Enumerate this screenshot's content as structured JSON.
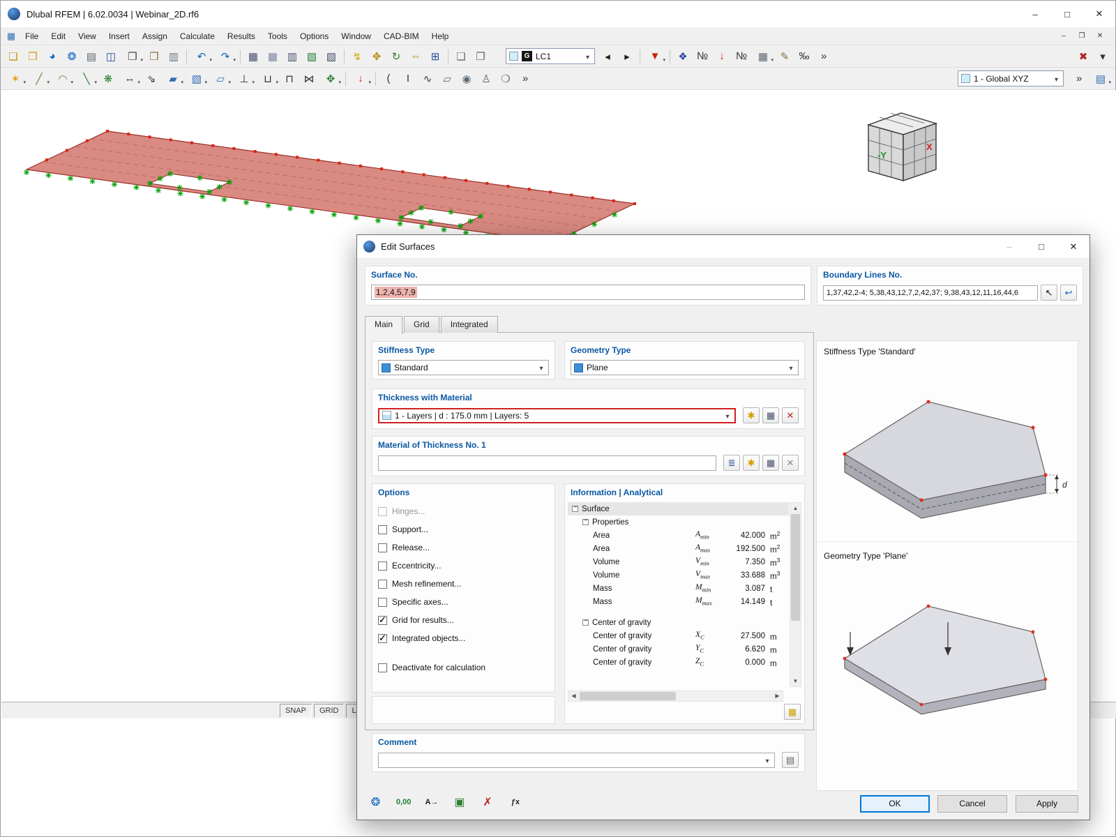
{
  "colors": {
    "label_blue": "#0a58a5",
    "selection_pink": "#f0b4af",
    "highlight_red": "#d02020",
    "surface_red": "#d98a82",
    "support_green": "#00a000",
    "accent_blue": "#0078d7"
  },
  "main_window": {
    "title": "Dlubal RFEM | 6.02.0034 | Webinar_2D.rf6",
    "win_controls": {
      "minimize": "–",
      "maximize": "□",
      "close": "✕"
    },
    "mdi_controls": {
      "minimize": "‒",
      "restore": "❐",
      "close": "✕"
    },
    "menu": [
      "File",
      "Edit",
      "View",
      "Insert",
      "Assign",
      "Calculate",
      "Results",
      "Tools",
      "Options",
      "Window",
      "CAD-BIM",
      "Help"
    ],
    "toolbar_main": [
      {
        "name": "new-model-icon",
        "g": "❏",
        "c": "#c79100"
      },
      {
        "name": "open-model-icon",
        "g": "❐",
        "c": "#d79a00"
      },
      {
        "name": "dlubal-center-icon",
        "g": "◕",
        "c": "#1565c0"
      },
      {
        "name": "dlubal-web-icon",
        "g": "❂",
        "c": "#1565c0"
      },
      {
        "name": "printout-report-icon",
        "g": "▤",
        "c": "#5b6770"
      },
      {
        "name": "save-icon",
        "g": "◫",
        "c": "#24489a"
      },
      {
        "name": "print-icon",
        "g": "❒",
        "c": "#444444",
        "dd": true
      },
      {
        "name": "copy-icon",
        "g": "❐",
        "c": "#8a6d3b"
      },
      {
        "name": "note-icon",
        "g": "▥",
        "c": "#667788"
      },
      {
        "sep": true
      },
      {
        "name": "undo-icon",
        "g": "↶",
        "c": "#1565c0",
        "dd": true
      },
      {
        "name": "redo-icon",
        "g": "↷",
        "c": "#1565c0",
        "dd": true
      },
      {
        "sep": true
      },
      {
        "name": "tables-icon",
        "g": "▦",
        "c": "#44506a"
      },
      {
        "name": "result-tables-icon",
        "g": "▦",
        "c": "#7a86a0"
      },
      {
        "name": "printout-tables-icon",
        "g": "▥",
        "c": "#44506a"
      },
      {
        "name": "export-tables-icon",
        "g": "▧",
        "c": "#1e7e34"
      },
      {
        "name": "table-settings-icon",
        "g": "▨",
        "c": "#44506a"
      },
      {
        "sep": true
      },
      {
        "name": "generate-load-icon",
        "g": "↯",
        "c": "#d2a000"
      },
      {
        "name": "move-copy-icon",
        "g": "✥",
        "c": "#b8860b"
      },
      {
        "name": "rotate-icon",
        "g": "↻",
        "c": "#2e7d32"
      },
      {
        "name": "mirror-icon",
        "g": "⇔",
        "c": "#b8860b"
      },
      {
        "name": "divide-icon",
        "g": "⊞",
        "c": "#24489a"
      },
      {
        "sep": true
      },
      {
        "name": "view-sheet-icon",
        "g": "❏",
        "c": "#5b6770"
      },
      {
        "name": "view-sheet-2-icon",
        "g": "❐",
        "c": "#5b6770"
      }
    ],
    "load_case": {
      "badge": "G",
      "value": "LC1"
    },
    "toolbar_main_right": [
      {
        "name": "previous-load-case-icon",
        "g": "◂",
        "c": "#222222"
      },
      {
        "name": "next-load-case-icon",
        "g": "▸",
        "c": "#222222"
      },
      {
        "sep": true
      },
      {
        "name": "filter-loads-icon",
        "g": "▼",
        "c": "#cc2200",
        "dd": true
      },
      {
        "sep": true
      },
      {
        "name": "display-properties-icon",
        "g": "❖",
        "c": "#24489a"
      },
      {
        "name": "object-numbering-icon",
        "g": "№",
        "c": "#333333"
      },
      {
        "name": "show-loads-icon",
        "g": "↓",
        "c": "#cc2200"
      },
      {
        "name": "show-values-icon",
        "g": "№",
        "c": "#333333"
      },
      {
        "name": "results-grid-icon",
        "g": "▦",
        "c": "#5b6770",
        "dd": true
      },
      {
        "name": "comment-pencil-icon",
        "g": "✎",
        "c": "#8a6d3b"
      },
      {
        "name": "decimals-icon",
        "g": "‰",
        "c": "#333333"
      },
      {
        "name": "toolbar-overflow-icon",
        "g": "»",
        "c": "#333333"
      },
      {
        "spring": true
      },
      {
        "name": "zoom-cancel-icon",
        "g": "✖",
        "c": "#bb2222"
      },
      {
        "name": "toolbar-menu-icon",
        "g": "▾",
        "c": "#333333"
      }
    ],
    "toolbar_insert": [
      {
        "name": "new-node-icon",
        "g": "✶",
        "c": "#e0a000",
        "dd": true
      },
      {
        "name": "new-line-icon",
        "g": "╱",
        "c": "#8a6d3b",
        "dd": true
      },
      {
        "name": "new-arc-icon",
        "g": "◠",
        "c": "#8a6d3b",
        "dd": true
      },
      {
        "name": "new-member-icon",
        "g": "╲",
        "c": "#2e7d32",
        "dd": true
      },
      {
        "name": "new-member-set-icon",
        "g": "❋",
        "c": "#2e7d32"
      },
      {
        "name": "dimension-icon",
        "g": "↔",
        "c": "#333333",
        "dd": true
      },
      {
        "name": "dimension-slope-icon",
        "g": "⇘",
        "c": "#333333"
      },
      {
        "name": "new-surface-icon",
        "g": "▰",
        "c": "#2f6fb5",
        "dd": true
      },
      {
        "name": "new-solid-icon",
        "g": "▧",
        "c": "#2f6fb5",
        "dd": true
      },
      {
        "name": "new-opening-icon",
        "g": "▱",
        "c": "#2f6fb5",
        "dd": true
      },
      {
        "name": "nodal-support-icon",
        "g": "⊥",
        "c": "#333333",
        "dd": true
      },
      {
        "name": "line-support-icon",
        "g": "⊔",
        "c": "#333333",
        "dd": true
      },
      {
        "name": "line-hinge-icon",
        "g": "⊓",
        "c": "#333333"
      },
      {
        "name": "member-hinge-icon",
        "g": "⋈",
        "c": "#333333"
      },
      {
        "name": "surface-axes-icon",
        "g": "✥",
        "c": "#2e7d32",
        "dd": true
      },
      {
        "sep": true
      },
      {
        "name": "new-load-icon",
        "g": "↓",
        "c": "#cc2200",
        "dd": true
      },
      {
        "sep": true
      },
      {
        "name": "section-cut-icon",
        "g": "(",
        "c": "#333333"
      },
      {
        "name": "profile-icon",
        "g": "I",
        "c": "#333333"
      },
      {
        "name": "curve-icon",
        "g": "∿",
        "c": "#333333"
      },
      {
        "name": "clipping-plane-icon",
        "g": "▱",
        "c": "#5b6770"
      },
      {
        "name": "camera-icon",
        "g": "◉",
        "c": "#5b6770"
      },
      {
        "name": "walk-through-icon",
        "g": "♙",
        "c": "#5b6770"
      },
      {
        "name": "rendering-icon",
        "g": "❍",
        "c": "#5b6770"
      },
      {
        "name": "toolbar-overflow-icon",
        "g": "»",
        "c": "#333333"
      }
    ],
    "coord_system": {
      "value": "1 - Global XYZ"
    },
    "toolbar_insert_end": [
      {
        "name": "toolbar-overflow-2-icon",
        "g": "»",
        "c": "#333333"
      },
      {
        "name": "panel-toggle-icon",
        "g": "▤",
        "c": "#2f6fb5",
        "dd": true
      }
    ],
    "status_bar": [
      "SNAP",
      "GRID",
      "LGRID"
    ],
    "nav_cube": {
      "front_label": "-Y",
      "right_label": "X"
    }
  },
  "dialog": {
    "title": "Edit Surfaces",
    "controls": {
      "minimize": "–",
      "maximize": "□",
      "close": "✕"
    },
    "surface_no": {
      "label": "Surface No.",
      "value": "1,2,4,5,7,9"
    },
    "boundary_lines": {
      "label": "Boundary Lines No.",
      "value": "1,37,42,2-4; 5,38,43,12,7,2,42,37; 9,38,43,12,11,16,44,6"
    },
    "tabs": [
      {
        "label": "Main",
        "active": true
      },
      {
        "label": "Grid"
      },
      {
        "label": "Integrated"
      }
    ],
    "stiffness_type": {
      "label": "Stiffness Type",
      "value": "Standard"
    },
    "geometry_type": {
      "label": "Geometry Type",
      "value": "Plane"
    },
    "thickness": {
      "label": "Thickness with Material",
      "value": "1 - Layers | d : 175.0 mm | Layers: 5"
    },
    "material": {
      "label": "Material of Thickness No. 1",
      "value": ""
    },
    "options": {
      "label": "Options",
      "items": [
        {
          "label": "Hinges...",
          "disabled": true
        },
        {
          "label": "Support..."
        },
        {
          "label": "Release..."
        },
        {
          "label": "Eccentricity..."
        },
        {
          "label": "Mesh refinement..."
        },
        {
          "label": "Specific axes..."
        },
        {
          "label": "Grid for results...",
          "checked": true
        },
        {
          "label": "Integrated objects...",
          "checked": true
        },
        {
          "label": "Deactivate for calculation",
          "gap": true
        }
      ]
    },
    "information": {
      "label": "Information | Analytical",
      "rows": [
        {
          "label": "Surface",
          "root": true
        },
        {
          "label": "Properties",
          "group": true,
          "indent": 1
        },
        {
          "label": "Area",
          "sym": "A",
          "sub": "min",
          "value": "42.000",
          "unit": "m",
          "sup": "2",
          "leaf": true,
          "indent": 2
        },
        {
          "label": "Area",
          "sym": "A",
          "sub": "max",
          "value": "192.500",
          "unit": "m",
          "sup": "2",
          "leaf": true,
          "indent": 2
        },
        {
          "label": "Volume",
          "sym": "V",
          "sub": "min",
          "value": "7.350",
          "unit": "m",
          "sup": "3",
          "leaf": true,
          "indent": 2
        },
        {
          "label": "Volume",
          "sym": "V",
          "sub": "max",
          "value": "33.688",
          "unit": "m",
          "sup": "3",
          "leaf": true,
          "indent": 2
        },
        {
          "label": "Mass",
          "sym": "M",
          "sub": "min",
          "value": "3.087",
          "unit": "t",
          "leaf": true,
          "indent": 2
        },
        {
          "label": "Mass",
          "sym": "M",
          "sub": "max",
          "value": "14.149",
          "unit": "t",
          "leaf": true,
          "indent": 2
        },
        {
          "spacer": true
        },
        {
          "label": "Center of gravity",
          "group": true,
          "indent": 1
        },
        {
          "label": "Center of gravity",
          "sym": "X",
          "sub": "C",
          "value": "27.500",
          "unit": "m",
          "leaf": true,
          "indent": 2
        },
        {
          "label": "Center of gravity",
          "sym": "Y",
          "sub": "C",
          "value": "6.620",
          "unit": "m",
          "leaf": true,
          "indent": 2
        },
        {
          "label": "Center of gravity",
          "sym": "Z",
          "sub": "C",
          "value": "0.000",
          "unit": "m",
          "leaf": true,
          "indent": 2
        }
      ]
    },
    "icons": {
      "select": "↖",
      "reset": "↩",
      "new_thickness": "✱",
      "edit_thickness": "▦",
      "delete_thickness": "✕",
      "library": "≣",
      "new_material": "✱",
      "edit_material": "▦",
      "delete_material": "✕",
      "comment_templates": "▤",
      "info_export": "▦"
    },
    "footer_icons": [
      {
        "name": "help-center-icon",
        "g": "❂",
        "c": "#1565c0"
      },
      {
        "name": "decimal-places-icon",
        "g": "0,00",
        "c": "#1e7e34",
        "small": true
      },
      {
        "name": "units-icon",
        "g": "A→",
        "c": "#222222",
        "small": true
      },
      {
        "name": "screenshot-icon",
        "g": "▣",
        "c": "#2e7d32"
      },
      {
        "name": "delete-icon",
        "g": "✗",
        "c": "#bb2222"
      },
      {
        "name": "formula-icon",
        "g": "ƒx",
        "c": "#222222",
        "small": true
      }
    ],
    "previews": {
      "stiffness_label": "Stiffness Type 'Standard'",
      "geometry_label": "Geometry Type 'Plane'",
      "d_label": "d"
    },
    "comment": {
      "label": "Comment"
    },
    "buttons": {
      "ok": "OK",
      "cancel": "Cancel",
      "apply": "Apply"
    }
  }
}
